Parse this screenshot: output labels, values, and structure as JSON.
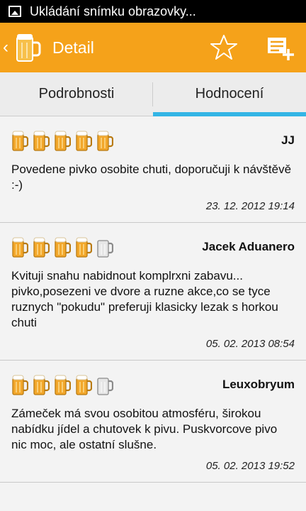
{
  "status_bar": {
    "text": "Ukládání snímku obrazovky..."
  },
  "action_bar": {
    "title": "Detail",
    "up_icon": "chevron-left-icon",
    "logo_icon": "beer-mug-logo",
    "favorite_icon": "star-outline-icon",
    "add_icon": "add-review-icon"
  },
  "tabs": [
    {
      "label": "Podrobnosti",
      "active": false
    },
    {
      "label": "Hodnocení",
      "active": true
    }
  ],
  "colors": {
    "accent": "#f5a21a",
    "tab_indicator": "#33b5e5",
    "beer_full": "#f2a72b",
    "mug_empty": "#bdbdbd"
  },
  "reviews": [
    {
      "rating": 5,
      "max_rating": 5,
      "author": "JJ",
      "text": "Povedene pivko osobite chuti, doporučuji k návštěvě :-)",
      "date": "23. 12. 2012 19:14"
    },
    {
      "rating": 4,
      "max_rating": 5,
      "author": "Jacek Aduanero",
      "text": "Kvituji snahu nabidnout komplrxni zabavu... pivko,posezeni ve dvore a ruzne akce,co se tyce ruznych \"pokudu\" preferuji klasicky lezak s horkou chuti",
      "date": "05. 02. 2013 08:54"
    },
    {
      "rating": 4,
      "max_rating": 5,
      "author": "Leuxobryum",
      "text": "Zámeček má svou osobitou atmosféru, širokou nabídku jídel a chutovek k pivu. Puskvorcove pivo nic moc, ale ostatní slušne.",
      "date": "05. 02. 2013 19:52"
    }
  ]
}
